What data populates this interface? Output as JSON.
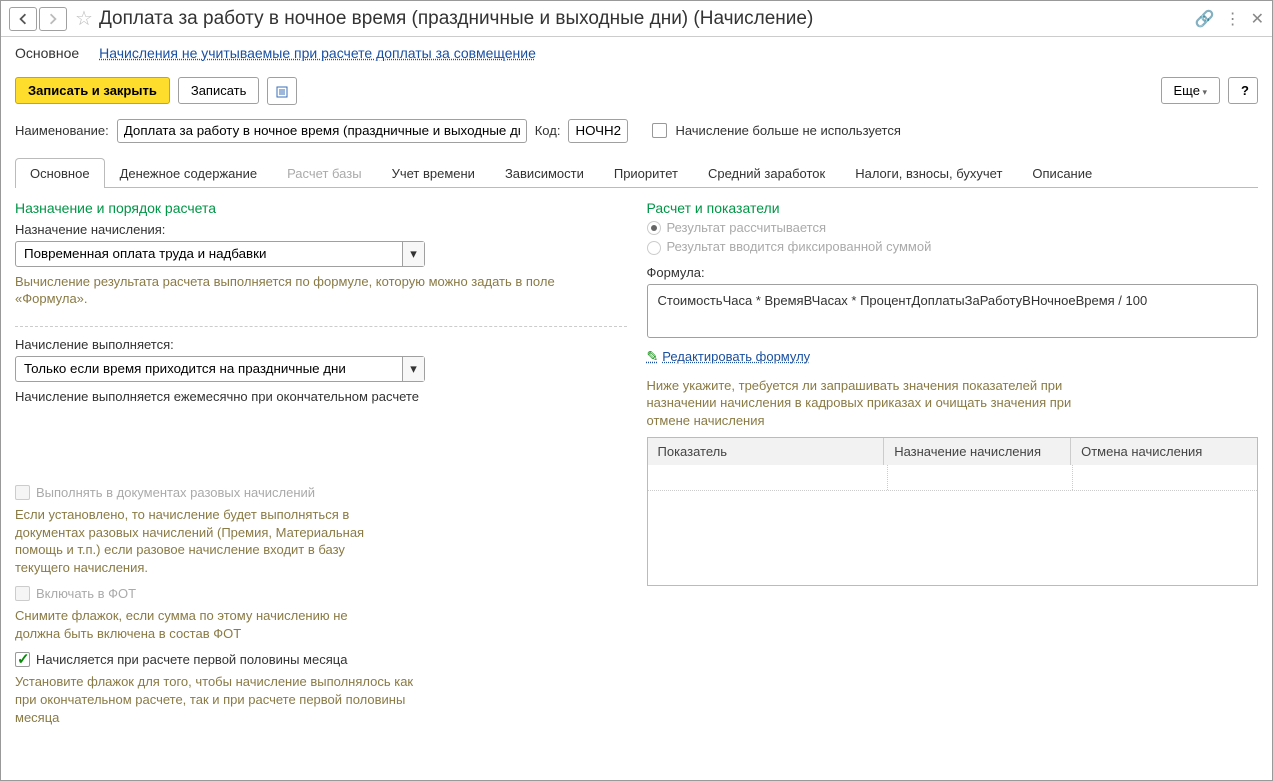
{
  "title": "Доплата за работу в ночное время (праздничные и выходные дни) (Начисление)",
  "nav": {
    "main": "Основное",
    "link": "Начисления не учитываемые при расчете доплаты за совмещение"
  },
  "toolbar": {
    "save_close": "Записать и закрыть",
    "save": "Записать",
    "more": "Еще",
    "help": "?"
  },
  "fields": {
    "name_label": "Наименование:",
    "name_value": "Доплата за работу в ночное время (праздничные и выходные дни)",
    "code_label": "Код:",
    "code_value": "НОЧН2",
    "not_used": "Начисление больше не используется"
  },
  "tabs": [
    "Основное",
    "Денежное содержание",
    "Расчет базы",
    "Учет времени",
    "Зависимости",
    "Приоритет",
    "Средний заработок",
    "Налоги, взносы, бухучет",
    "Описание"
  ],
  "left": {
    "sect1": "Назначение и порядок расчета",
    "purpose_label": "Назначение начисления:",
    "purpose_value": "Повременная оплата труда и надбавки",
    "purpose_hint": "Вычисление результата расчета выполняется по формуле, которую можно задать в поле «Формула».",
    "when_label": "Начисление выполняется:",
    "when_value": "Только если время приходится на праздничные дни",
    "when_hint": "Начисление выполняется ежемесячно при окончательном расчете",
    "chk1": "Выполнять в документах разовых начислений",
    "chk1_hint": "Если установлено, то начисление будет выполняться в документах разовых начислений (Премия, Материальная помощь и т.п.) если разовое начисление входит в базу текущего начисления.",
    "chk2": "Включать в ФОТ",
    "chk2_hint": "Снимите флажок, если сумма по этому начислению не должна быть включена в состав ФОТ",
    "chk3": "Начисляется при расчете первой половины месяца",
    "chk3_hint": "Установите флажок для того, чтобы начисление выполнялось как при окончательном расчете, так и при расчете первой половины месяца"
  },
  "right": {
    "sect": "Расчет и показатели",
    "r1": "Результат рассчитывается",
    "r2": "Результат вводится фиксированной суммой",
    "formula_label": "Формула:",
    "formula": "СтоимостьЧаса * ВремяВЧасах * ПроцентДоплатыЗаРаботуВНочноеВремя / 100",
    "edit": "Редактировать формулу",
    "note": "Ниже укажите, требуется ли запрашивать значения показателей при назначении начисления в кадровых приказах и очищать значения при отмене начисления",
    "th1": "Показатель",
    "th2": "Назначение начисления",
    "th3": "Отмена начисления"
  }
}
